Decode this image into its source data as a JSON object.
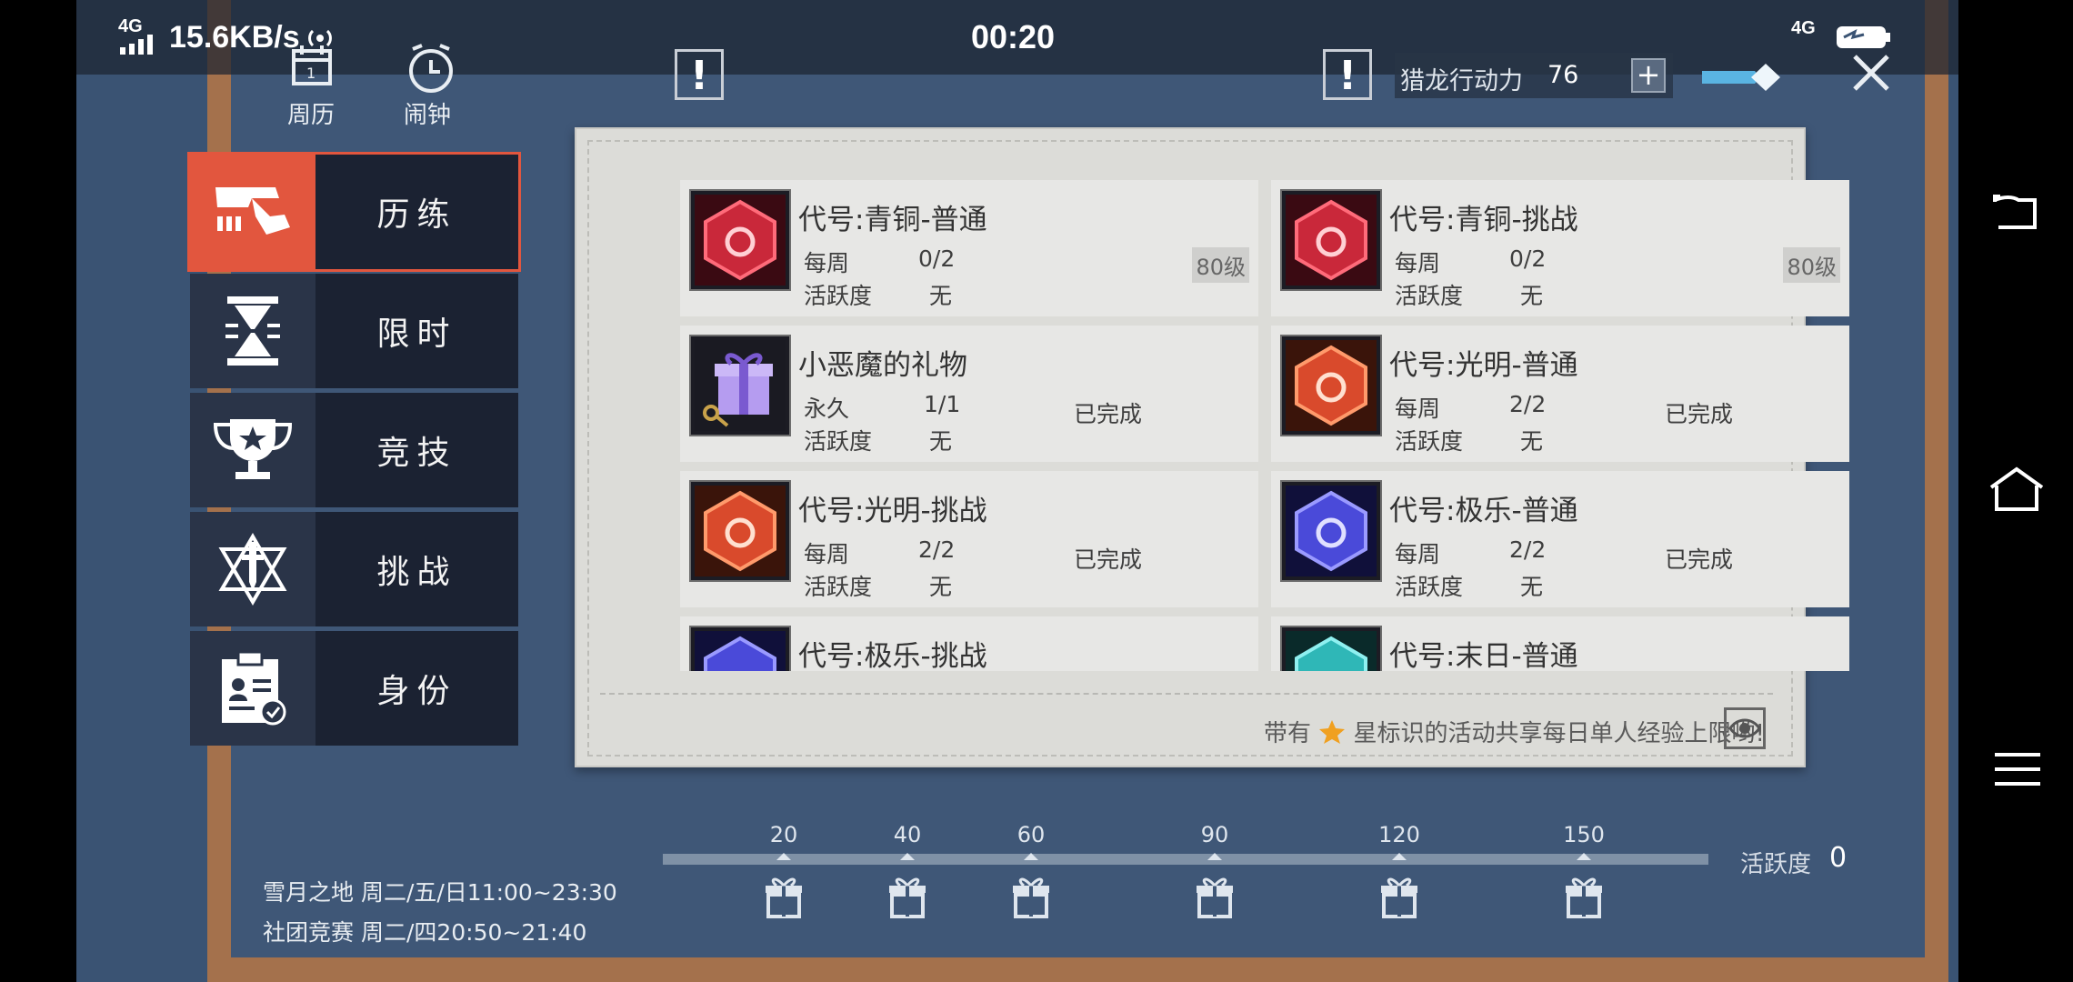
{
  "status_bar": {
    "network_left": "4G",
    "speed": "15.6KB/s",
    "time": "00:20",
    "network_right": "4G"
  },
  "top_icons": {
    "calendar_label": "周历",
    "alarm_label": "闹钟"
  },
  "currency": {
    "label": "猎龙行动力",
    "value": "76",
    "add_symbol": "+"
  },
  "nav": [
    {
      "label": "历练",
      "icon": "pistol-icon",
      "active": true
    },
    {
      "label": "限时",
      "icon": "hourglass-icon",
      "active": false
    },
    {
      "label": "竞技",
      "icon": "trophy-icon",
      "active": false
    },
    {
      "label": "挑战",
      "icon": "sword-star-icon",
      "active": false
    },
    {
      "label": "身份",
      "icon": "id-badge-icon",
      "active": false
    }
  ],
  "activities": [
    {
      "title": "代号:青铜-普通",
      "period": "每周",
      "progress": "0/2",
      "activity_label": "活跃度",
      "activity_value": "无",
      "level": "80级",
      "status": "",
      "color": "#c9283a"
    },
    {
      "title": "代号:青铜-挑战",
      "period": "每周",
      "progress": "0/2",
      "activity_label": "活跃度",
      "activity_value": "无",
      "level": "80级",
      "status": "",
      "color": "#c9283a"
    },
    {
      "title": "小恶魔的礼物",
      "period": "永久",
      "progress": "1/1",
      "activity_label": "活跃度",
      "activity_value": "无",
      "level": "",
      "status": "已完成",
      "color": "#9d7ae0"
    },
    {
      "title": "代号:光明-普通",
      "period": "每周",
      "progress": "2/2",
      "activity_label": "活跃度",
      "activity_value": "无",
      "level": "",
      "status": "已完成",
      "color": "#d94a2c"
    },
    {
      "title": "代号:光明-挑战",
      "period": "每周",
      "progress": "2/2",
      "activity_label": "活跃度",
      "activity_value": "无",
      "level": "",
      "status": "已完成",
      "color": "#d94a2c"
    },
    {
      "title": "代号:极乐-普通",
      "period": "每周",
      "progress": "2/2",
      "activity_label": "活跃度",
      "activity_value": "无",
      "level": "",
      "status": "已完成",
      "color": "#4a4ad9"
    },
    {
      "title": "代号:极乐-挑战",
      "period": "",
      "progress": "",
      "activity_label": "",
      "activity_value": "",
      "level": "",
      "status": "",
      "color": "#4a4ad9"
    },
    {
      "title": "代号:末日-普通",
      "period": "",
      "progress": "",
      "activity_label": "",
      "activity_value": "",
      "level": "",
      "status": "",
      "color": "#2fb7b7"
    }
  ],
  "footer_note": {
    "prefix": "带有",
    "suffix": "星标识的活动共享每日单人经验上限哟!"
  },
  "rewards": {
    "thresholds": [
      "20",
      "40",
      "60",
      "90",
      "120",
      "150"
    ],
    "label": "活跃度",
    "value": "0"
  },
  "schedule": [
    "雪月之地 周二/五/日11:00~23:30",
    "社团竞赛 周二/四20:50~21:40"
  ]
}
